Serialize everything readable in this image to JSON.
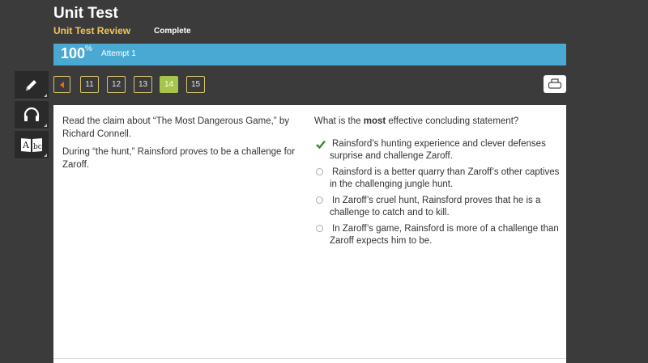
{
  "header": {
    "title": "Unit Test",
    "subtitle": "Unit Test Review",
    "status": "Complete"
  },
  "progress": {
    "percent_value": "100",
    "percent_sign": "%",
    "attempt": "Attempt 1",
    "fraction": 1.0
  },
  "tools": [
    {
      "icon": "pencil-icon"
    },
    {
      "icon": "headphones-icon"
    },
    {
      "icon": "dictionary-icon"
    }
  ],
  "nav": {
    "pages": [
      "11",
      "12",
      "13",
      "14",
      "15"
    ],
    "active": "14"
  },
  "content": {
    "passage": [
      "Read the claim about “The Most Dangerous Game,” by Richard Connell.",
      "During “the hunt,” Rainsford proves to be a challenge for Zaroff."
    ],
    "question_pre": "What is the ",
    "question_bold": "most",
    "question_post": " effective concluding statement?",
    "options": [
      {
        "text": "Rainsford’s hunting experience and clever defenses surprise and challenge Zaroff.",
        "state": "correct"
      },
      {
        "text": "Rainsford is a better quarry than Zaroff’s other captives in the challenging jungle hunt.",
        "state": "unselected"
      },
      {
        "text": "In Zaroff’s cruel hunt, Rainsford proves that he is a challenge to catch and to kill.",
        "state": "unselected"
      },
      {
        "text": "In Zaroff’s game, Rainsford is more of a challenge than Zaroff expects him to be.",
        "state": "unselected"
      }
    ]
  },
  "colors": {
    "background": "#3b3b3b",
    "accent_yellow": "#f1c75b",
    "progress_blue": "#4aa9d2",
    "active_green": "#a7c44c",
    "check_green": "#3a8a2e",
    "prev_arrow": "#e86a1f"
  }
}
